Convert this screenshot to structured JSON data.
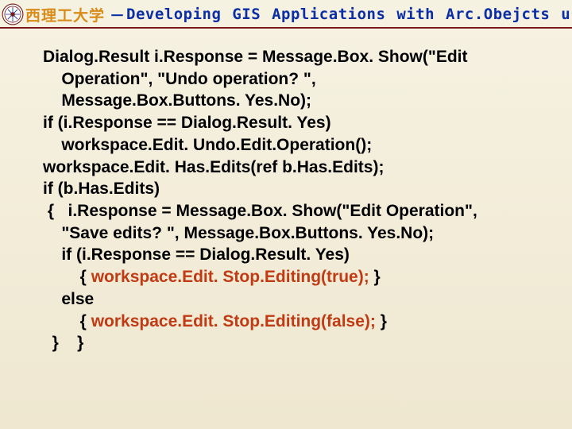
{
  "header": {
    "university": "西理工大学",
    "separator": "－",
    "course": "Developing GIS Applications with Arc.Obejcts using C#. NE"
  },
  "code": {
    "l1": "Dialog.Result i.Response = Message.Box. Show(\"Edit",
    "l2": "    Operation\", \"Undo operation? \",",
    "l3": "    Message.Box.Buttons. Yes.No);",
    "l4": "if (i.Response == Dialog.Result. Yes)",
    "l5": "    workspace.Edit. Undo.Edit.Operation();",
    "l6": "workspace.Edit. Has.Edits(ref b.Has.Edits);",
    "l7": "if (b.Has.Edits)",
    "l8": " {   i.Response = Message.Box. Show(\"Edit Operation\",",
    "l9": "    \"Save edits? \", Message.Box.Buttons. Yes.No);",
    "l10": "    if (i.Response == Dialog.Result. Yes)",
    "l11a": "        { ",
    "l11b": "workspace.Edit. Stop.Editing(true);",
    "l11c": " }",
    "l12": "    else",
    "l13a": "        { ",
    "l13b": "workspace.Edit. Stop.Editing(false);",
    "l13c": " }",
    "l14": "  }    }"
  }
}
